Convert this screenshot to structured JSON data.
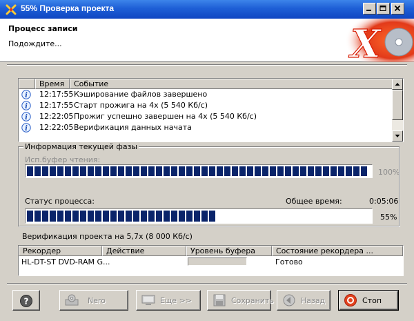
{
  "window": {
    "title": "55% Проверка проекта"
  },
  "header": {
    "title": "Процесс записи",
    "subtitle": "Подождите...",
    "logo_text": "X"
  },
  "log": {
    "columns": [
      "Время",
      "Событие"
    ],
    "rows": [
      {
        "icon": "info-icon",
        "time": "12:17:55",
        "event": "Кэширование файлов завершено"
      },
      {
        "icon": "info-icon",
        "time": "12:17:55",
        "event": "Старт прожига на 4x (5 540 Кб/с)"
      },
      {
        "icon": "info-icon",
        "time": "12:22:05",
        "event": "Прожиг успешно завершен на 4x (5 540 Кб/с)"
      },
      {
        "icon": "info-icon",
        "time": "12:22:05",
        "event": "Верификация данных начата"
      }
    ]
  },
  "phase": {
    "legend": "Информация текущей фазы",
    "read_buffer_label": "Исп.буфер чтения:",
    "read_buffer_value": "100%",
    "read_buffer_fraction": 1.0,
    "status_label": "Статус процесса:",
    "total_time_label": "Общее время:",
    "total_time_value": "0:05:06",
    "progress_value": "55%",
    "progress_fraction": 0.55
  },
  "status_line": "Верификация проекта на 5,7x (8 000 Кб/с)",
  "recorders": {
    "columns": [
      "Рекордер",
      "Действие",
      "Уровень буфера",
      "Состояние рекордера ..."
    ],
    "rows": [
      {
        "recorder": "HL-DT-ST DVD-RAM G...",
        "action": "",
        "buffer_fraction": 0,
        "state": "Готово"
      }
    ]
  },
  "buttons": {
    "help": "?",
    "nero": "Nero",
    "more": "Еще >>",
    "save": "Сохранить",
    "back": "Назад",
    "stop": "Стоп"
  },
  "colors": {
    "titlebar": "#1e5fd6",
    "progress": "#0a246a",
    "face": "#d4d0c8",
    "stop_accent": "#cc2a14"
  }
}
